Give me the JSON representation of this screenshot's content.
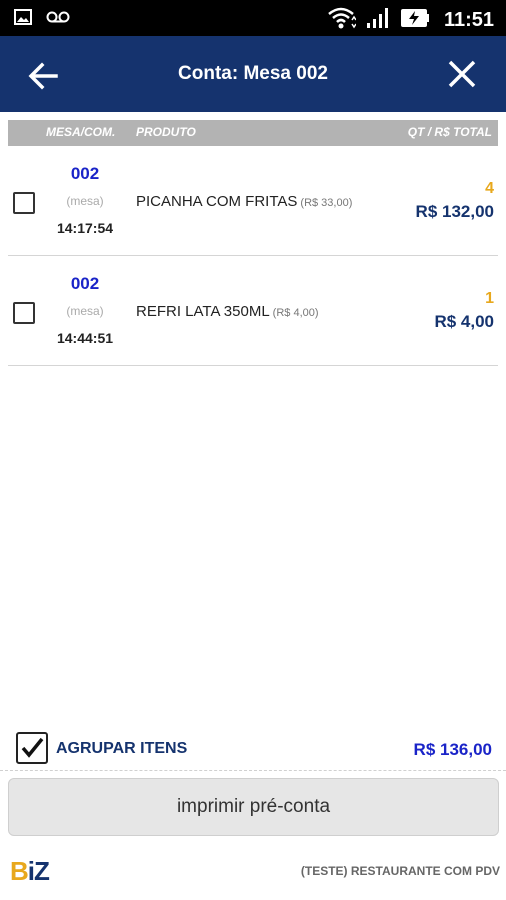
{
  "status_bar": {
    "time": "11:51",
    "left_icons": [
      "image-icon",
      "voicemail-icon"
    ],
    "right_icons": [
      "wifi-icon",
      "signal-icon",
      "battery-charging-icon"
    ]
  },
  "app_bar": {
    "title": "Conta: Mesa 002"
  },
  "table": {
    "headers": {
      "mesa": "MESA/COM.",
      "produto": "PRODUTO",
      "total": "QT / R$ TOTAL"
    },
    "rows": [
      {
        "mesa": "002",
        "mesa_type": "(mesa)",
        "time": "14:17:54",
        "produto": "PICANHA COM FRITAS",
        "unit_price": "(R$ 33,00)",
        "qty": "4",
        "total": "R$ 132,00"
      },
      {
        "mesa": "002",
        "mesa_type": "(mesa)",
        "time": "14:44:51",
        "produto": "REFRI LATA 350ML",
        "unit_price": "(R$ 4,00)",
        "qty": "1",
        "total": "R$ 4,00"
      }
    ]
  },
  "summary": {
    "group_label": "AGRUPAR ITENS",
    "group_checked": true,
    "grand_total": "R$ 136,00"
  },
  "print_button": "imprimir pré-conta",
  "footer": {
    "logo_b": "B",
    "logo_iz": "iZ",
    "restaurant": "(TESTE) RESTAURANTE COM PDV"
  },
  "colors": {
    "app_bar": "#15336e",
    "qty": "#e8a81d",
    "mesa": "#1a24c8",
    "total": "#15336e"
  }
}
